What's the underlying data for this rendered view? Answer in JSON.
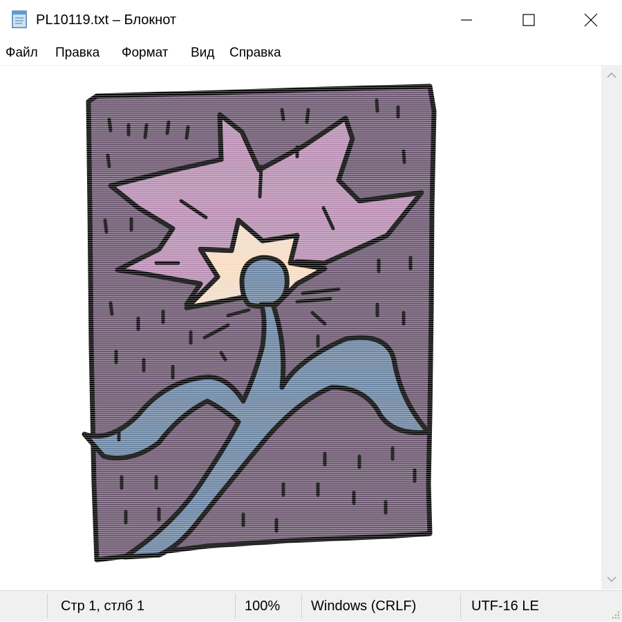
{
  "window": {
    "title": "PL10119.txt – Блокнот",
    "icon": "notepad-icon",
    "controls": [
      "minimize-icon",
      "maximize-icon",
      "close-icon"
    ]
  },
  "menu": {
    "items": [
      "Файл",
      "Правка",
      "Формат",
      "Вид",
      "Справка"
    ]
  },
  "editor": {
    "content": "ascii-art flower picture rendered as colored text lines",
    "colors": {
      "background_purple": "#6e5a72",
      "petal_pink": "#b98fb3",
      "center_cream": "#f5dcc4",
      "stem_blue": "#6c86a3",
      "outline": "#0d0d0d"
    }
  },
  "status": {
    "position": "Стр 1, стлб 1",
    "zoom": "100%",
    "line_ending": "Windows (CRLF)",
    "encoding": "UTF-16 LE"
  }
}
